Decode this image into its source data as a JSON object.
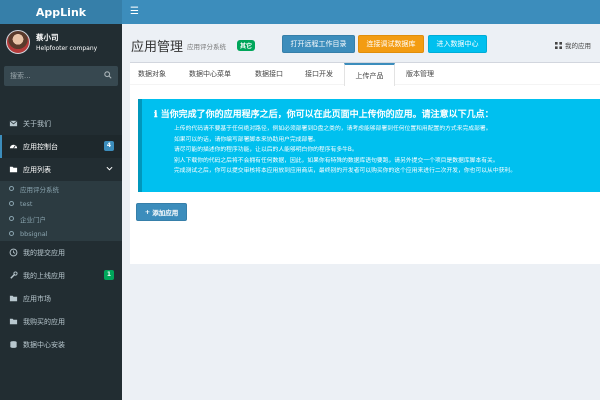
{
  "brand": "AppLink",
  "topbar": {
    "toggle_icon": "hamburger-icon"
  },
  "user": {
    "name": "蔡小司",
    "company": "Helpfooter company"
  },
  "search": {
    "placeholder": "搜索..."
  },
  "menu": {
    "items": [
      {
        "label": "关于我们",
        "icon": "envelope-icon"
      },
      {
        "label": "应用控制台",
        "icon": "dashboard-icon",
        "badge": "4",
        "badge_color": "#3c8dbc"
      },
      {
        "label": "应用列表",
        "icon": "folder-icon"
      },
      {
        "label": "我的提交应用",
        "icon": "clock-icon"
      },
      {
        "label": "我的上线应用",
        "icon": "wrench-icon",
        "badge": "1",
        "badge_color": "#00a65a"
      },
      {
        "label": "应用市场",
        "icon": "folder-icon"
      },
      {
        "label": "我购买的应用",
        "icon": "folder-icon"
      },
      {
        "label": "数据中心安装",
        "icon": "database-icon"
      }
    ],
    "subitems": [
      "应用评分系统",
      "test",
      "企业门户",
      "bbsignal"
    ]
  },
  "header": {
    "title": "应用管理",
    "subtitle": "应用评分系统",
    "version_badge": "其它",
    "buttons": [
      "打开远程工作目录",
      "连接调试数据库",
      "进入数据中心"
    ],
    "my_apps": "我的应用"
  },
  "tabs": [
    "数据对象",
    "数据中心菜单",
    "数据接口",
    "接口开发",
    "上传产品",
    "版本管理"
  ],
  "active_tab": "上传产品",
  "callout": {
    "title": "当你完成了你的应用程序之后，你可以在此页面中上传你的应用。请注意以下几点：",
    "items": [
      "上传的代码请不要基于任何绝对路径，例如必须部署到D盘之类的，请考虑能够部署到任何位置和用配置的方式来完成部署。",
      "如果可以的话，请你编写部署脚本来协助用户完成部署。",
      "请尽可能的描述你的程序功能，让以后的人能够明白你的程序有多牛B。",
      "别人下载你的代码之后将不会拥有任何数据，因此，如果你有特殊的数据库语句要跑，请另外提交一个项目是数据库脚本有关。",
      "完成测试之后，你可以提交审核将本应用放到应用商店，最终别的开发者可以购买你的这个应用来进行二次开发，你也可以从中获利。"
    ]
  },
  "add_button": "添加应用",
  "colors": {
    "primary": "#3c8dbc",
    "sidebar": "#222d32",
    "info": "#00c0ef",
    "warning": "#f39c12",
    "success": "#00a65a"
  }
}
